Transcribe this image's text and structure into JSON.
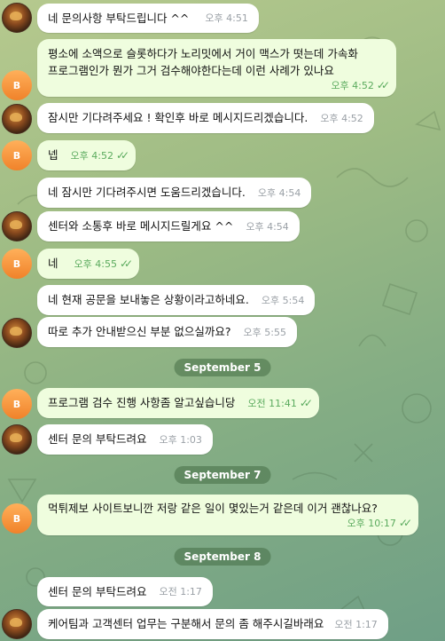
{
  "chat": {
    "messages": [
      {
        "id": "m1",
        "text": "네 문의사항 부탁드립니다 ^^",
        "time": "오후 4:51"
      },
      {
        "id": "m2",
        "line1": "평소에 소액으로 슬롯하다가 노리밋에서 거이 맥스가 떳는데 가속화",
        "line2": "프로그램인가 뭔가 그거 검수해야한다는데 이런 사례가 있나요",
        "time": "오후 4:52"
      },
      {
        "id": "m3",
        "text": "잠시만 기다려주세요 ! 확인후 바로 메시지드리겠습니다.",
        "time": "오후 4:52"
      },
      {
        "id": "m4",
        "text": "넵",
        "time": "오후 4:52"
      },
      {
        "id": "m5",
        "text": "네 잠시만 기다려주시면 도움드리겠습니다.",
        "time": "오후 4:54"
      },
      {
        "id": "m6",
        "text": "센터와 소통후 바로 메시지드릴게요 ^^",
        "time": "오후 4:54"
      },
      {
        "id": "m7",
        "text": "네",
        "time": "오후 4:55"
      },
      {
        "id": "m8",
        "text": "네 현재 공문을 보내놓은 상황이라고하네요.",
        "time": "오후 5:54"
      },
      {
        "id": "m9",
        "text": "따로 추가 안내받으신 부분 없으실까요?",
        "time": "오후 5:55"
      },
      {
        "id": "m10",
        "text": "프로그램 검수 진행 사항좀 알고싶습니당",
        "time": "오전 11:41"
      },
      {
        "id": "m11",
        "text": "센터 문의 부탁드려요",
        "time": "오후 1:03"
      },
      {
        "id": "m12",
        "text": "먹튀제보 사이트보니깐 저랑 같은 일이 몇있는거 같은데 이거 괜찮나요?",
        "time": "오후 10:17"
      },
      {
        "id": "m13",
        "text": "센터 문의 부탁드려요",
        "time": "오전 1:17"
      },
      {
        "id": "m14",
        "text": "케어팀과 고객센터 업무는 구분해서 문의 좀 해주시길바래요",
        "time": "오전 1:17"
      }
    ],
    "dates": {
      "d1": "September 5",
      "d2": "September 7",
      "d3": "September 8"
    },
    "user_initial": "B",
    "read_mark": "✓✓"
  }
}
